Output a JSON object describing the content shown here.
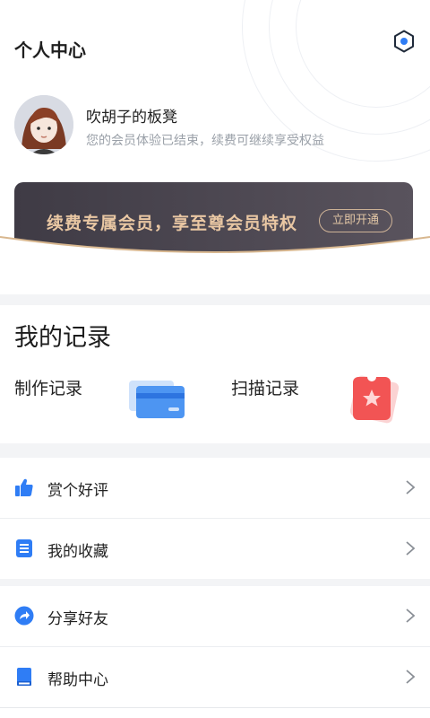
{
  "header": {
    "title": "个人中心",
    "settings_icon": "hexagon-settings-icon"
  },
  "user": {
    "name": "吹胡子的板凳",
    "status": "您的会员体验已结束，续费可继续享受权益",
    "avatar_icon": "user-avatar"
  },
  "vip_banner": {
    "text": "续费专属会员，享至尊会员特权",
    "button_label": "立即开通",
    "colors": {
      "background": "#45404a",
      "gold": "#e9c7a3"
    }
  },
  "records": {
    "title": "我的记录",
    "items": [
      {
        "label": "制作记录",
        "icon": "card-icon"
      },
      {
        "label": "扫描记录",
        "icon": "ticket-star-icon"
      }
    ]
  },
  "menu_groups": [
    [
      {
        "label": "赏个好评",
        "icon": "thumbs-up-icon"
      },
      {
        "label": "我的收藏",
        "icon": "document-list-icon"
      }
    ],
    [
      {
        "label": "分享好友",
        "icon": "share-arrow-icon"
      },
      {
        "label": "帮助中心",
        "icon": "help-book-icon"
      }
    ]
  ],
  "colors": {
    "accent": "#2f7df5",
    "background": "#f3f4f6"
  }
}
